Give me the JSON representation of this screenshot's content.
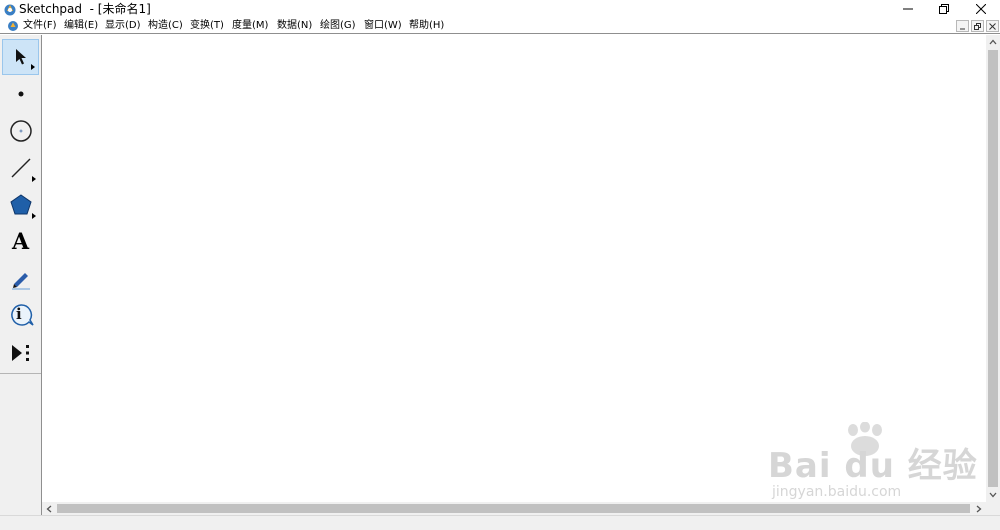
{
  "window": {
    "title": "Sketchpad  - [未命名1]",
    "controls": {
      "minimize": "minimize",
      "restore": "restore",
      "close": "close"
    }
  },
  "menubar": {
    "items": [
      {
        "label": "文件(F)"
      },
      {
        "label": "编辑(E)"
      },
      {
        "label": "显示(D)"
      },
      {
        "label": "构造(C)"
      },
      {
        "label": "变换(T)"
      },
      {
        "label": "度量(M)"
      },
      {
        "label": "数据(N)"
      },
      {
        "label": "绘图(G)"
      },
      {
        "label": "窗口(W)"
      },
      {
        "label": "帮助(H)"
      }
    ]
  },
  "toolbox": {
    "tools": [
      {
        "name": "selection-arrow-tool",
        "icon": "arrow-icon",
        "selected": true
      },
      {
        "name": "point-tool",
        "icon": "point-icon"
      },
      {
        "name": "compass-tool",
        "icon": "circle-icon"
      },
      {
        "name": "straightedge-tool",
        "icon": "line-icon"
      },
      {
        "name": "polygon-tool",
        "icon": "pentagon-icon"
      },
      {
        "name": "text-tool",
        "icon": "text-a-icon",
        "glyph": "A"
      },
      {
        "name": "marker-tool",
        "icon": "pen-icon"
      },
      {
        "name": "information-tool",
        "icon": "info-icon",
        "glyph": "i"
      },
      {
        "name": "custom-tool",
        "icon": "play-dots-icon"
      }
    ]
  },
  "watermark": {
    "logo_text": "Bai  du 经验",
    "url": "jingyan.baidu.com"
  },
  "colors": {
    "selected_tool_bg": "#cde4f7",
    "polygon_fill": "#1f5fa8",
    "marker_blue": "#2a5caa"
  }
}
